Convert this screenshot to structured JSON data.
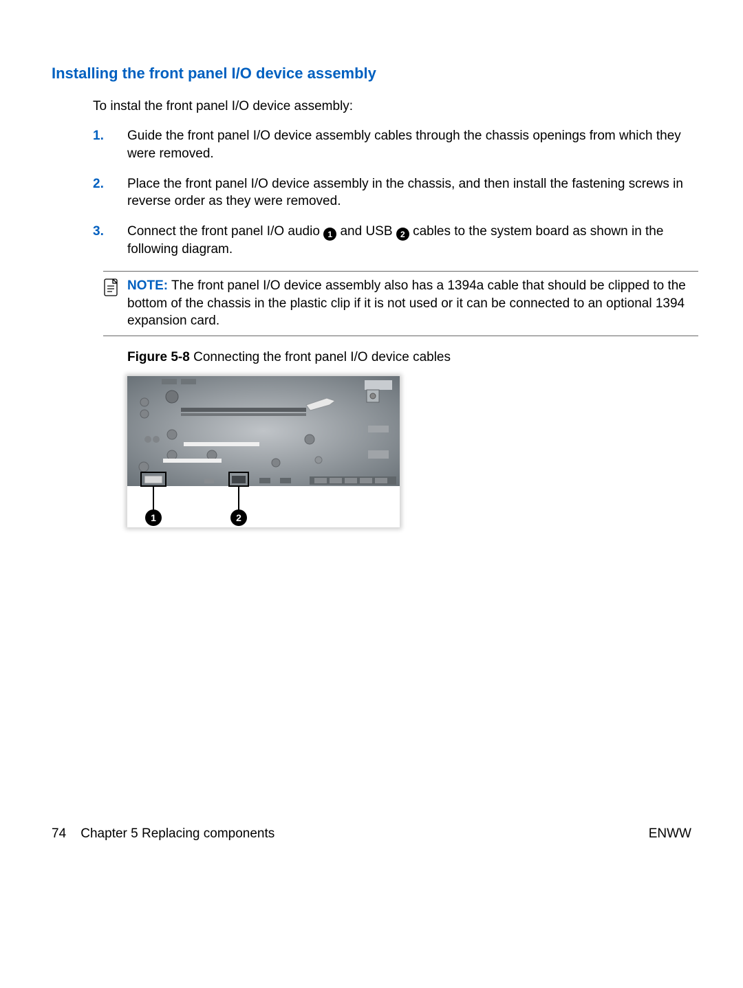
{
  "heading": "Installing the front panel I/O device assembly",
  "intro": "To instal the front panel I/O device assembly:",
  "steps": [
    {
      "num": "1.",
      "text": "Guide the front panel I/O device assembly cables through the chassis openings from which they were removed."
    },
    {
      "num": "2.",
      "text": "Place the front panel I/O device assembly in the chassis, and then install the fastening screws in reverse order as they were removed."
    },
    {
      "num": "3.",
      "before": "Connect the front panel I/O audio ",
      "callout1": "1",
      "mid": " and USB ",
      "callout2": "2",
      "after": " cables to the system board as shown in the following diagram."
    }
  ],
  "note": {
    "label": "NOTE:",
    "text": "The front panel I/O device assembly also has a 1394a cable that should be clipped to the bottom of the chassis in the plastic clip if it is not used or it can be connected to an optional 1394 expansion card."
  },
  "figure": {
    "label": "Figure 5-8",
    "caption": "  Connecting the front panel I/O device cables",
    "callouts": [
      "1",
      "2"
    ]
  },
  "footer": {
    "page": "74",
    "chapter": "Chapter 5   Replacing components",
    "right": "ENWW"
  }
}
